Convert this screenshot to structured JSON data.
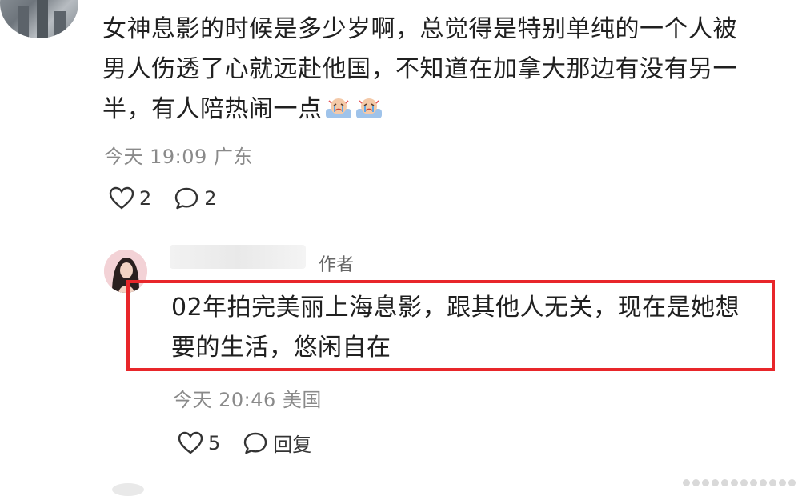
{
  "comment": {
    "text": "女神息影的时候是多少岁啊，总觉得是特别单纯的一个人被男人伤透了心就远赴他国，不知道在加拿大那边有没有另一半，有人陪热闹一点",
    "emoji_icons": [
      "crying-bath-emoji-icon",
      "crying-bath-emoji-icon"
    ],
    "time": "今天 19:09",
    "location": "广东",
    "like_count": "2",
    "reply_count": "2"
  },
  "reply": {
    "author_tag": "作者",
    "text": "02年拍完美丽上海息影，跟其他人无关，现在是她想要的生活，悠闲自在",
    "time": "今天 20:46",
    "location": "美国",
    "like_count": "5",
    "reply_label": "回复"
  },
  "colors": {
    "highlight_border": "#e8262a",
    "meta_text": "#8a8a8a",
    "body_text": "#202020"
  }
}
